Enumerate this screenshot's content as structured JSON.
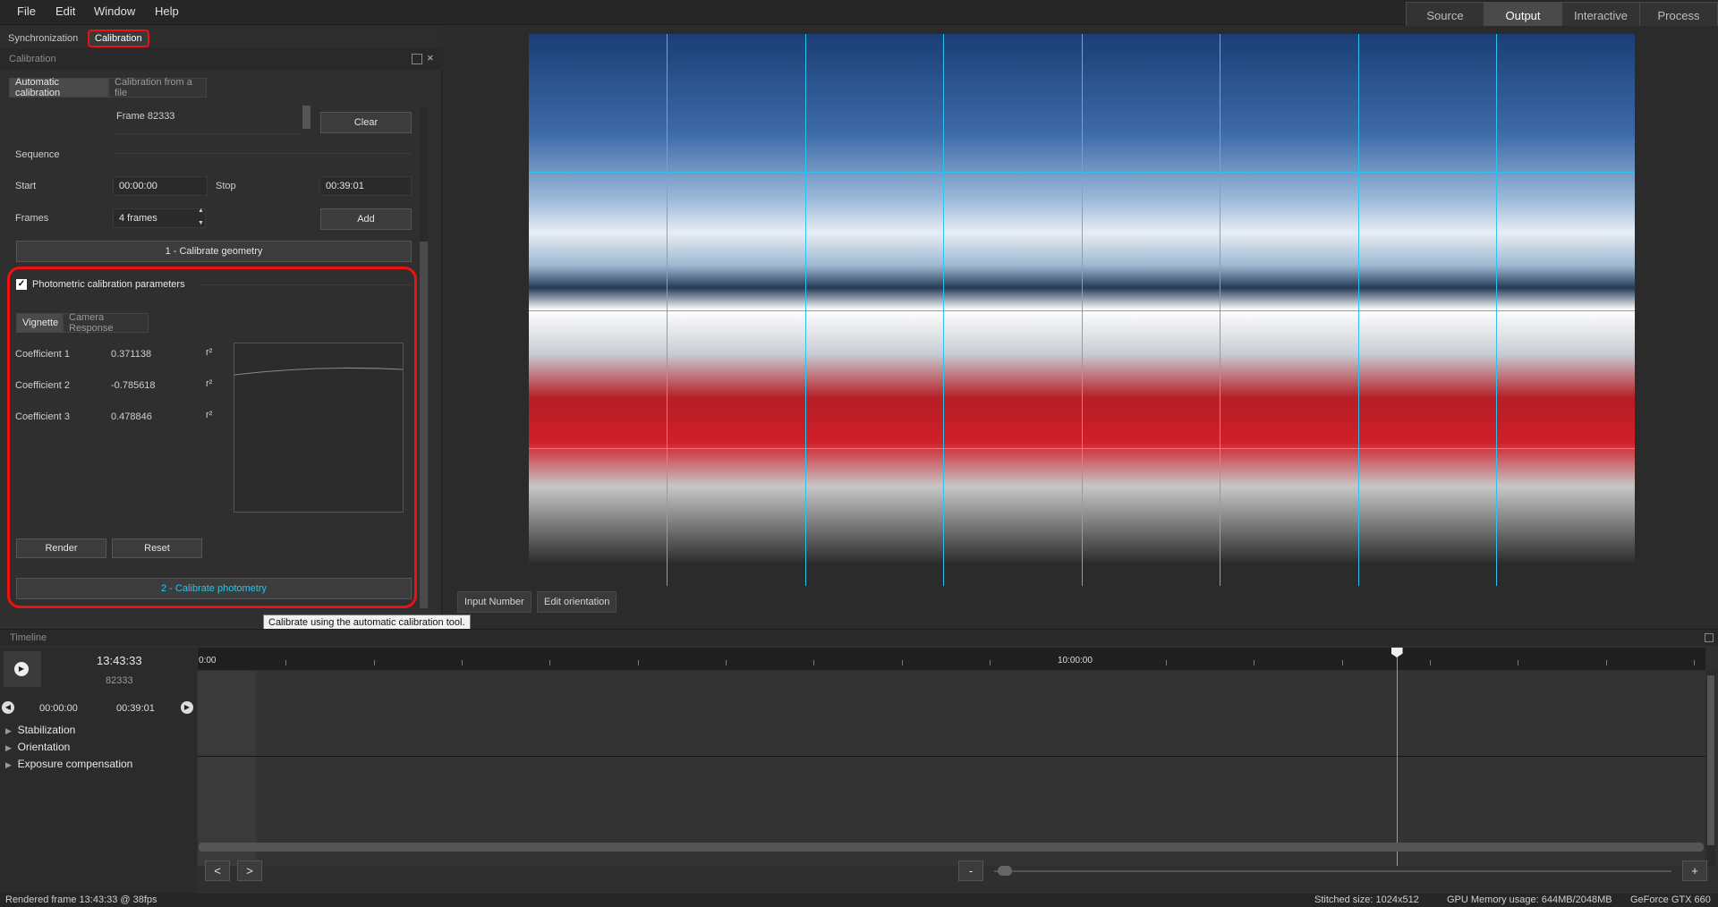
{
  "menu": [
    "File",
    "Edit",
    "Window",
    "Help"
  ],
  "mode_tabs": [
    {
      "label": "Source",
      "active": false
    },
    {
      "label": "Output",
      "active": true
    },
    {
      "label": "Interactive",
      "active": false
    },
    {
      "label": "Process",
      "active": false
    }
  ],
  "left_tabs": {
    "sync": "Synchronization",
    "calibration": "Calibration"
  },
  "panel": {
    "title": "Calibration",
    "subtabs": {
      "auto": "Automatic calibration",
      "file": "Calibration from a file"
    },
    "frame_item": "Frame 82333",
    "clear": "Clear",
    "sequence": "Sequence",
    "start_label": "Start",
    "start_value": "00:00:00",
    "stop_label": "Stop",
    "stop_value": "00:39:01",
    "frames_label": "Frames",
    "frames_value": "4 frames",
    "add": "Add",
    "calibrate_geometry": "1 - Calibrate geometry",
    "photometric_label": "Photometric calibration parameters",
    "photometric_checked": true,
    "photo_tabs": {
      "vignette": "Vignette",
      "response": "Camera Response"
    },
    "coefficients": [
      {
        "label": "Coefficient 1",
        "value": "0.371138",
        "unit": "r²"
      },
      {
        "label": "Coefficient 2",
        "value": "-0.785618",
        "unit": "r²"
      },
      {
        "label": "Coefficient 3",
        "value": "0.478846",
        "unit": "r²"
      }
    ],
    "render": "Render",
    "reset": "Reset",
    "calibrate_photometry": "2 - Calibrate photometry",
    "tooltip": "Calibrate using the automatic calibration tool."
  },
  "viewer": {
    "input_number": "Input Number",
    "edit_orientation": "Edit orientation"
  },
  "timeline": {
    "title": "Timeline",
    "current_time": "13:43:33",
    "current_frame": "82333",
    "range_start": "00:00:00",
    "range_end": "00:39:01",
    "tracks": [
      "Stabilization",
      "Orientation",
      "Exposure compensation"
    ],
    "ruler_start": "0:00",
    "ruler_mid": "10:00:00",
    "prev": "<",
    "next": ">",
    "zoom_out": "-",
    "zoom_in": "+",
    "playhead_fraction": 0.795
  },
  "status": {
    "left": "Rendered frame 13:43:33 @ 38fps",
    "stitched": "Stitched size: 1024x512",
    "gpu_mem": "GPU Memory usage: 644MB/2048MB",
    "gpu": "GeForce GTX 660"
  },
  "colors": {
    "accent": "#2dc3ee",
    "highlight": "#e11111"
  }
}
